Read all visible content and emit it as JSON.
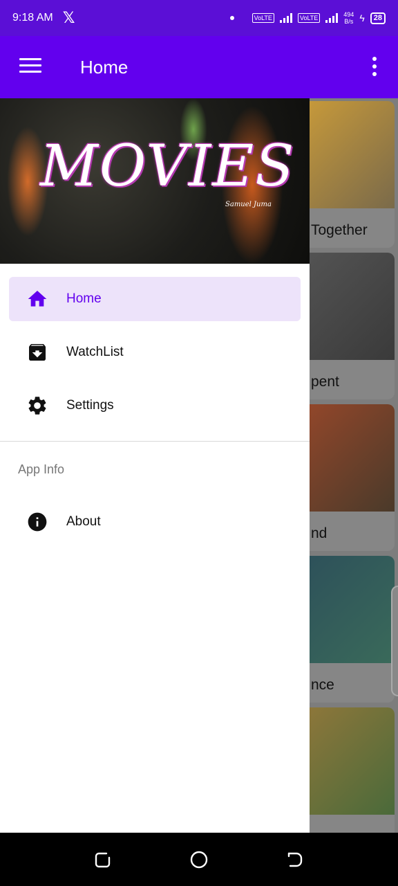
{
  "status_bar": {
    "time": "9:18 AM",
    "notification_icon": "x-logo-icon",
    "sim1": "VoLTE",
    "sim2": "VoLTE",
    "net_speed_value": "494",
    "net_speed_unit": "B/s",
    "battery": "28"
  },
  "app_bar": {
    "title": "Home"
  },
  "drawer": {
    "header_logo": "MOVIES",
    "header_signature": "Samuel Juma",
    "items": [
      {
        "label": "Home",
        "icon": "home-icon",
        "active": true
      },
      {
        "label": "WatchList",
        "icon": "watchlist-icon",
        "active": false
      },
      {
        "label": "Settings",
        "icon": "gear-icon",
        "active": false
      }
    ],
    "section_title": "App Info",
    "info_items": [
      {
        "label": "About",
        "icon": "info-icon"
      }
    ]
  },
  "movies": [
    {
      "title_visible": "Together"
    },
    {
      "title_visible": "pent"
    },
    {
      "title_visible": "nd"
    },
    {
      "title_visible": "nce"
    },
    {
      "title_visible": ""
    }
  ],
  "colors": {
    "primary": "#6200ee",
    "status_bar": "#5b0fd6",
    "active_item_bg": "#ede3fa"
  }
}
